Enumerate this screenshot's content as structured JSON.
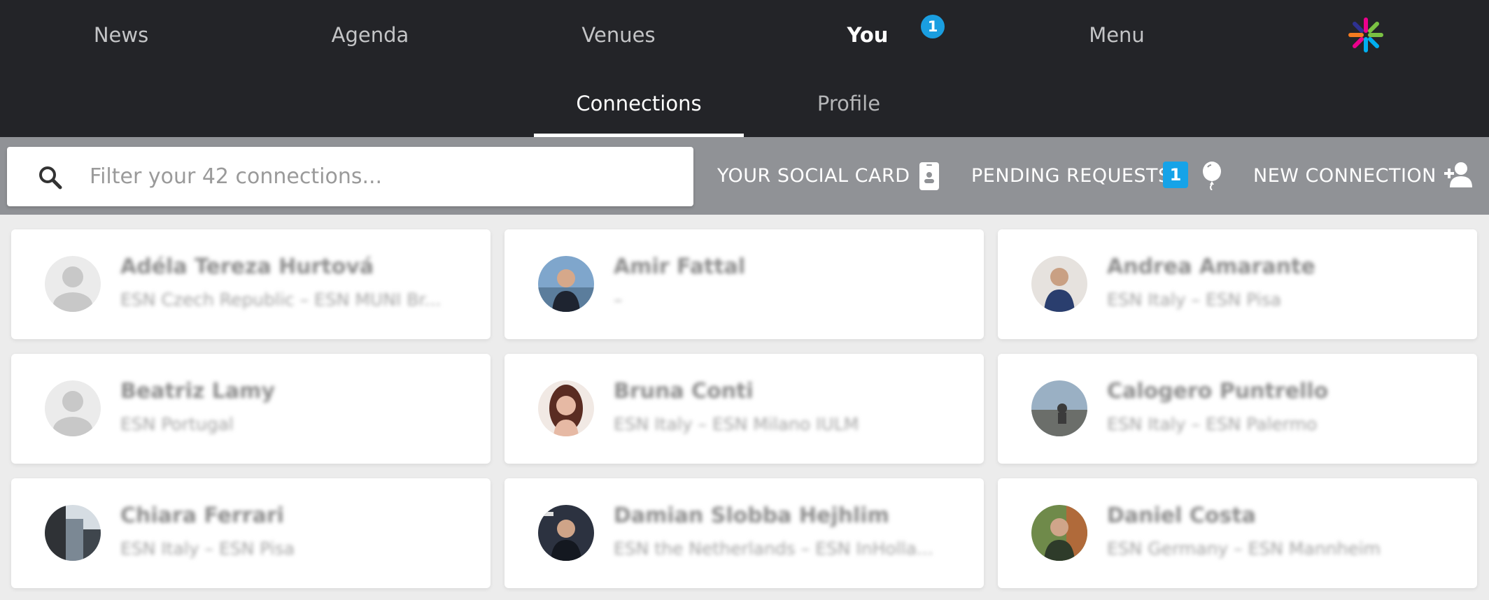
{
  "nav": {
    "items": [
      {
        "label": "News"
      },
      {
        "label": "Agenda"
      },
      {
        "label": "Venues"
      },
      {
        "label": "You"
      },
      {
        "label": "Menu"
      }
    ],
    "active": "You",
    "you_badge": "1",
    "logo_icon": "esn-star-logo-icon"
  },
  "subtabs": {
    "connections": "Connections",
    "profile": "Profile",
    "active": "Connections"
  },
  "toolbar": {
    "search_placeholder": "Filter your 42 connections...",
    "search_value": "",
    "social_card_label": "YOUR SOCIAL CARD",
    "pending_requests_label": "PENDING REQUESTS",
    "pending_badge": "1",
    "new_connection_label": "NEW CONNECTION"
  },
  "colors": {
    "nav_bg": "#232428",
    "toolbar_bg": "#909296",
    "accent_badge": "#1a9ee0",
    "page_bg": "#ececec"
  },
  "connections": [
    {
      "name": "Adéla Tereza Hurtová",
      "sub": "ESN Czech Republic – ESN MUNI Br...",
      "avatar": "placeholder"
    },
    {
      "name": "Amir Fattal",
      "sub": "–",
      "avatar": "photo"
    },
    {
      "name": "Andrea Amarante",
      "sub": "ESN Italy – ESN Pisa",
      "avatar": "photo"
    },
    {
      "name": "Beatriz Lamy",
      "sub": "ESN Portugal",
      "avatar": "placeholder"
    },
    {
      "name": "Bruna Conti",
      "sub": "ESN Italy – ESN Milano IULM",
      "avatar": "photo"
    },
    {
      "name": "Calogero Puntrello",
      "sub": "ESN Italy – ESN Palermo",
      "avatar": "photo"
    },
    {
      "name": "Chiara Ferrari",
      "sub": "ESN Italy – ESN Pisa",
      "avatar": "photo"
    },
    {
      "name": "Damian Slobba Hejhlim",
      "sub": "ESN the Netherlands – ESN InHolla...",
      "avatar": "photo"
    },
    {
      "name": "Daniel Costa",
      "sub": "ESN Germany – ESN Mannheim",
      "avatar": "photo"
    }
  ]
}
